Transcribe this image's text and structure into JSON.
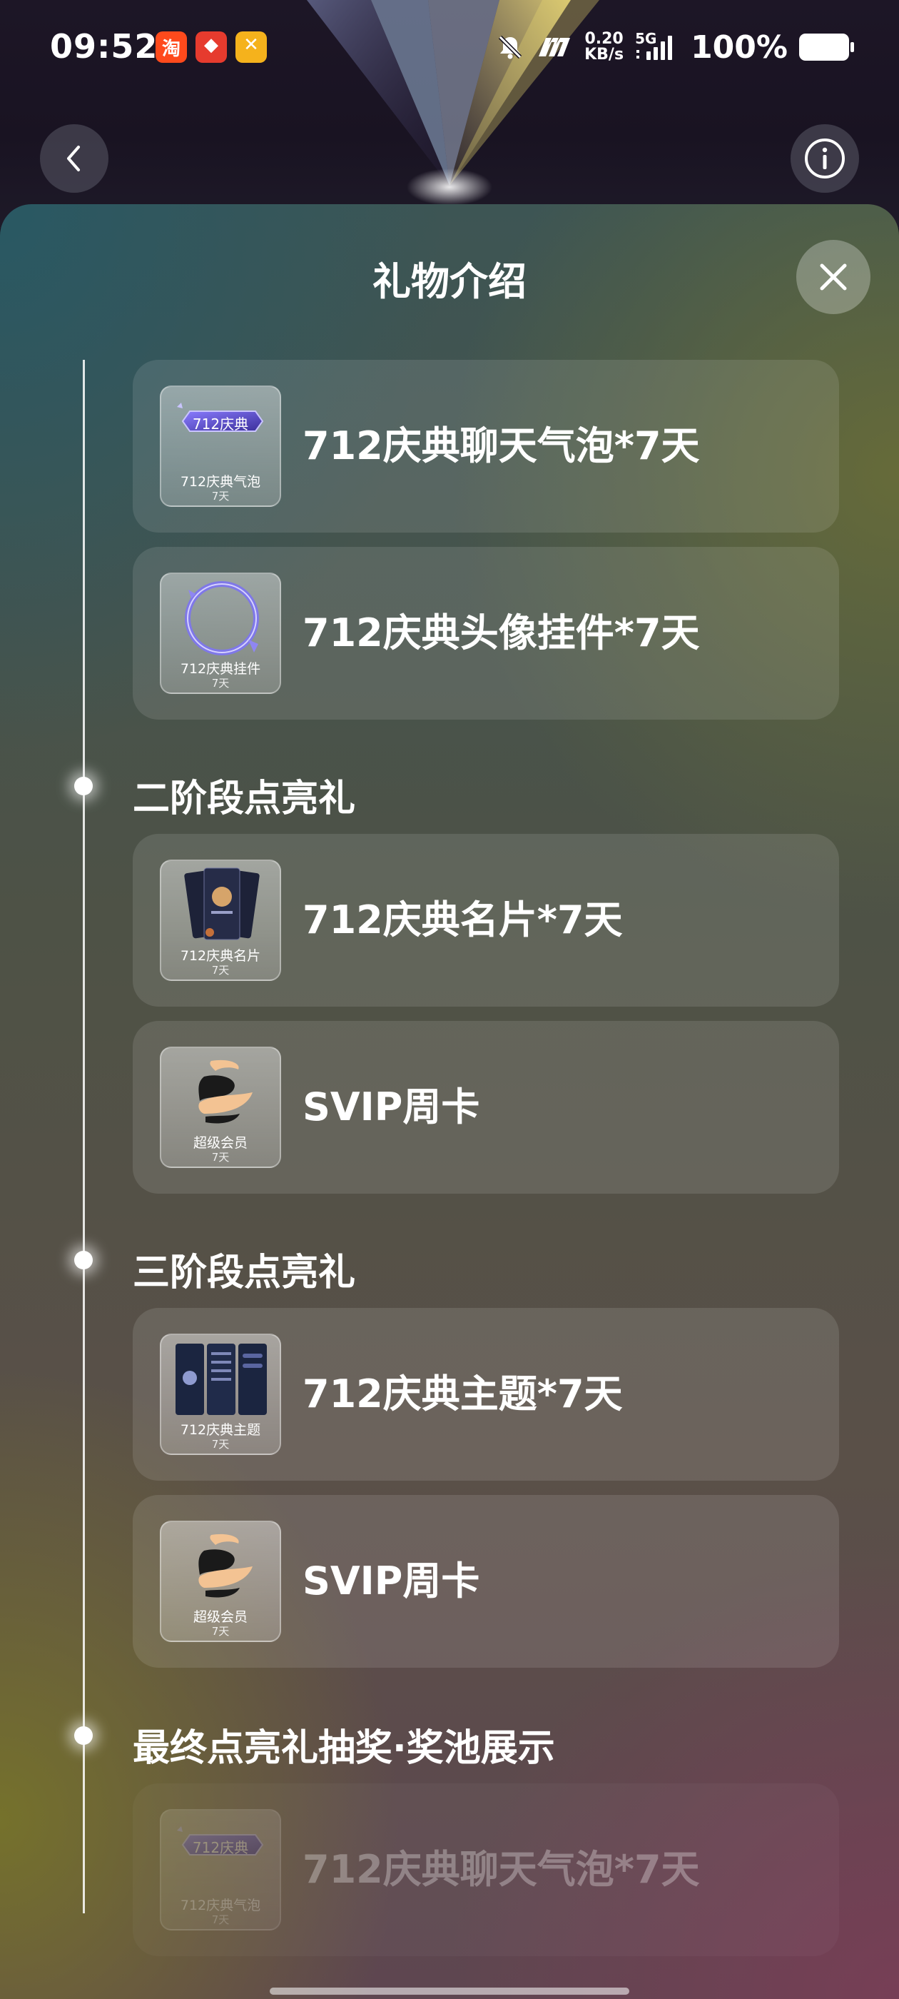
{
  "status_bar": {
    "time": "09:52",
    "net_speed_value": "0.20",
    "net_speed_unit": "KB/s",
    "network_type": "5G",
    "battery": "100%",
    "app_icons": [
      "taobao-icon",
      "red-app-icon",
      "yellow-app-icon"
    ],
    "icons": [
      "mute-icon",
      "m-brand-icon",
      "signal-icon",
      "battery-icon"
    ]
  },
  "nav": {
    "back_icon": "chevron-left-icon",
    "info_icon": "info-icon"
  },
  "sheet": {
    "title": "礼物介绍",
    "close_icon": "close-icon"
  },
  "items_group1": [
    {
      "thumb_label": "712庆典气泡",
      "thumb_sub": "7天",
      "name": "712庆典聊天气泡*7天",
      "badge_text": "712庆典"
    },
    {
      "thumb_label": "712庆典挂件",
      "thumb_sub": "7天",
      "name": "712庆典头像挂件*7天"
    }
  ],
  "section2": {
    "title": "二阶段点亮礼",
    "items": [
      {
        "thumb_label": "712庆典名片",
        "thumb_sub": "7天",
        "name": "712庆典名片*7天"
      },
      {
        "thumb_label": "超级会员",
        "thumb_sub": "7天",
        "name": "SVIP周卡"
      }
    ]
  },
  "section3": {
    "title": "三阶段点亮礼",
    "items": [
      {
        "thumb_label": "712庆典主题",
        "thumb_sub": "7天",
        "name": "712庆典主题*7天"
      },
      {
        "thumb_label": "超级会员",
        "thumb_sub": "7天",
        "name": "SVIP周卡"
      }
    ]
  },
  "section_final": {
    "title": "最终点亮礼抽奖·奖池展示",
    "items": [
      {
        "thumb_label": "712庆典气泡",
        "thumb_sub": "7天",
        "name": "712庆典聊天气泡*7天",
        "badge_text": "712庆典"
      }
    ]
  },
  "colors": {
    "sheet_teal": "#285864",
    "sheet_olive": "#686c38",
    "sheet_mauve": "#783e56",
    "accent_purple": "#6a5cff"
  }
}
